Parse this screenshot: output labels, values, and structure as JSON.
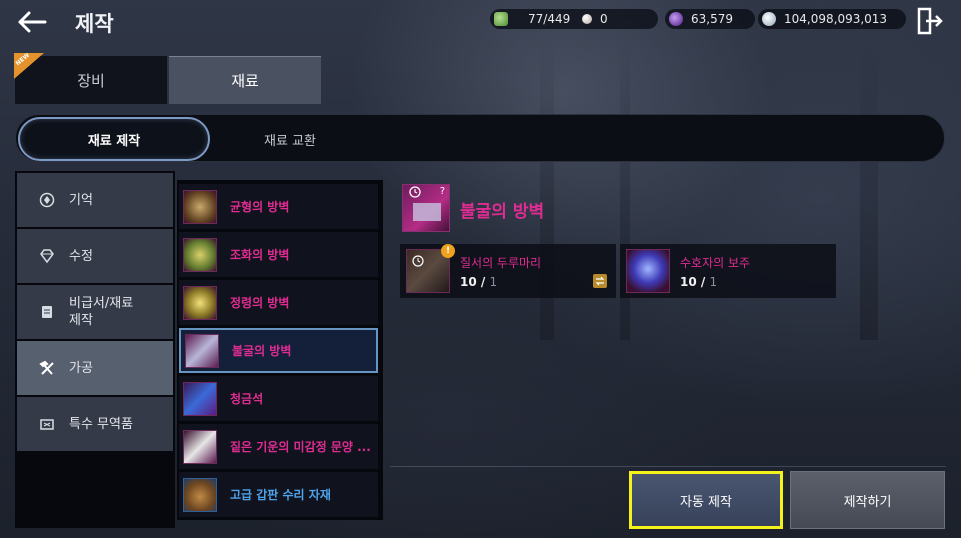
{
  "header": {
    "title": "제작",
    "currencies": [
      {
        "icon": "green-gem-icon",
        "value": "77/449",
        "color": "#5aa844"
      },
      {
        "icon": "pearl-icon",
        "value": "0",
        "color": "#d9cfc9"
      },
      {
        "icon": "purple-orb-icon",
        "value": "63,579",
        "color": "#7b3fbf"
      },
      {
        "icon": "silver-coin-icon",
        "value": "104,098,093,013",
        "color": "#c7d2dd"
      }
    ]
  },
  "main_tabs": {
    "equipment": "장비",
    "materials": "재료",
    "new_badge": "NEW"
  },
  "sub_tabs": {
    "material_craft": "재료 제작",
    "material_exchange": "재료 교환"
  },
  "categories": [
    {
      "label": "기억",
      "icon": "memory-icon"
    },
    {
      "label": "수정",
      "icon": "crystal-icon"
    },
    {
      "label": "비급서/재료\n제작",
      "icon": "scroll-icon"
    },
    {
      "label": "가공",
      "icon": "hammer-icon"
    },
    {
      "label": "특수 무역품",
      "icon": "trade-goods-icon"
    }
  ],
  "items": [
    {
      "label": "균형의 방벽",
      "color": "magenta"
    },
    {
      "label": "조화의 방벽",
      "color": "magenta"
    },
    {
      "label": "정령의 방벽",
      "color": "magenta"
    },
    {
      "label": "불굴의 방벽",
      "color": "magenta"
    },
    {
      "label": "청금석",
      "color": "magenta"
    },
    {
      "label": "짙은 기운의 미감정 문양 ...",
      "color": "magenta"
    },
    {
      "label": "고급 갑판 수리 자재",
      "color": "blue"
    }
  ],
  "detail": {
    "title": "불굴의 방벽",
    "thumb_badge": "?",
    "materials": [
      {
        "name": "질서의 두루마리",
        "have": "10",
        "need": "1",
        "alert": "!"
      },
      {
        "name": "수호자의 보주",
        "have": "10",
        "need": "1"
      }
    ]
  },
  "buttons": {
    "auto_craft": "자동 제작",
    "craft": "제작하기"
  },
  "colors": {
    "rarity_magenta": "#e02c92",
    "rarity_blue": "#4ea3ea",
    "highlight": "#f4f21a"
  }
}
